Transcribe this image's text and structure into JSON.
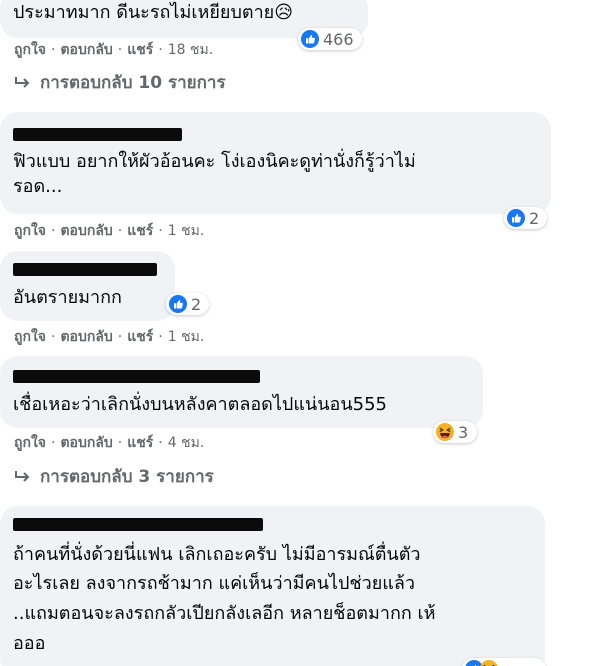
{
  "comments": [
    {
      "text_lines": [
        "ประมาทมาก ดีนะรถไม่เหยียบตาย😥"
      ],
      "actions": {
        "like": "ถูกใจ",
        "reply": "ตอบกลับ",
        "share": "แชร์",
        "time": "18 ชม."
      },
      "reaction": {
        "icon": "like-icon",
        "count": "466"
      },
      "replies_label": "การตอบกลับ 10 รายการ"
    },
    {
      "text_lines": [
        "ฟิวแบบ อยากให้ผัวอ้อนคะ โง่เองนิคะดูท่านั่งก็รู้ว่าไม่",
        "รอด..."
      ],
      "actions": {
        "like": "ถูกใจ",
        "reply": "ตอบกลับ",
        "share": "แชร์",
        "time": "1 ชม."
      },
      "reaction": {
        "icon": "like-icon",
        "count": "2"
      }
    },
    {
      "text_lines": [
        "อันตรายมากก"
      ],
      "actions": {
        "like": "ถูกใจ",
        "reply": "ตอบกลับ",
        "share": "แชร์",
        "time": "1 ชม."
      },
      "reaction": {
        "icon": "like-icon",
        "count": "2"
      }
    },
    {
      "text_lines": [
        "เชื่อเหอะว่าเลิกนั่งบนหลังคาตลอดไปแน่นอน555"
      ],
      "actions": {
        "like": "ถูกใจ",
        "reply": "ตอบกลับ",
        "share": "แชร์",
        "time": "4 ชม."
      },
      "reaction": {
        "icon": "haha-icon",
        "count": "3"
      },
      "replies_label": "การตอบกลับ 3 รายการ"
    },
    {
      "text_lines": [
        "ถ้าคนที่นั่งด้วยนี่แฟน เลิกเถอะครับ ไม่มีอารมณ์ตื่นตัว",
        "อะไรเลย ลงจากรถช้ามาก แค่เห็นว่ามีคนไปช่วยแล้ว",
        "..แถมตอนจะลงรถกลัวเปียกลังเลอีก หลายช็อตมากก เห้",
        "อออ"
      ]
    }
  ],
  "colors": {
    "bubble": "#f0f2f5",
    "meta_text": "#65676b",
    "like_blue": "#1877f2",
    "haha_yellow": "#f7b125"
  }
}
